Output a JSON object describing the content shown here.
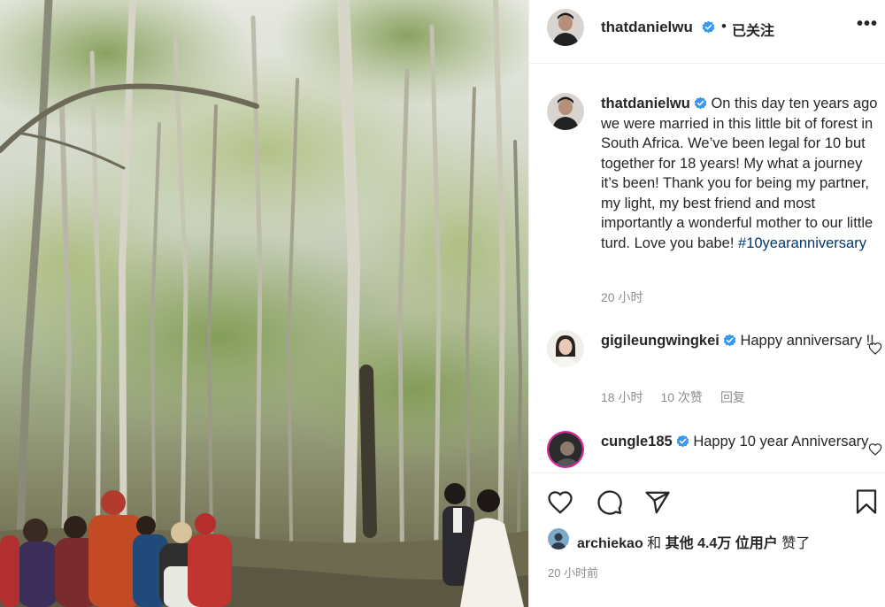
{
  "photo": {
    "description_icon": "forest-wedding-photo"
  },
  "post_header": {
    "username": "thatdanielwu",
    "separator": "•",
    "follow_status": "已关注",
    "more_label": "•••"
  },
  "caption": {
    "username": "thatdanielwu",
    "text": "On this day ten years ago we were married in this little bit of forest in South Africa. We’ve been legal for 10 but together for 18 years! My what a journey it’s been! Thank you for being my partner, my light, my best friend and most importantly a wonderful mother to our little turd. Love you babe! ",
    "hashtag": "#10yearanniversary",
    "time": "20 小时"
  },
  "comments": [
    {
      "username": "gigileungwingkei",
      "text": "Happy anniversary !!",
      "time": "18 小时",
      "likes": "10 次赞",
      "reply": "回复"
    },
    {
      "username": "cungle185",
      "text": "Happy 10 year Anniversary"
    }
  ],
  "likes": {
    "liker": "archiekao",
    "connector": "和",
    "others": "其他 4.4万 位用户",
    "suffix": "赞了"
  },
  "time_ago": "20 小时前",
  "colors": {
    "verified": "#3897f0",
    "link": "#00376b",
    "secondary": "#8e8e8e"
  },
  "icons": [
    "heart-icon",
    "comment-icon",
    "share-icon",
    "bookmark-icon",
    "more-icon",
    "verified-badge-icon"
  ]
}
